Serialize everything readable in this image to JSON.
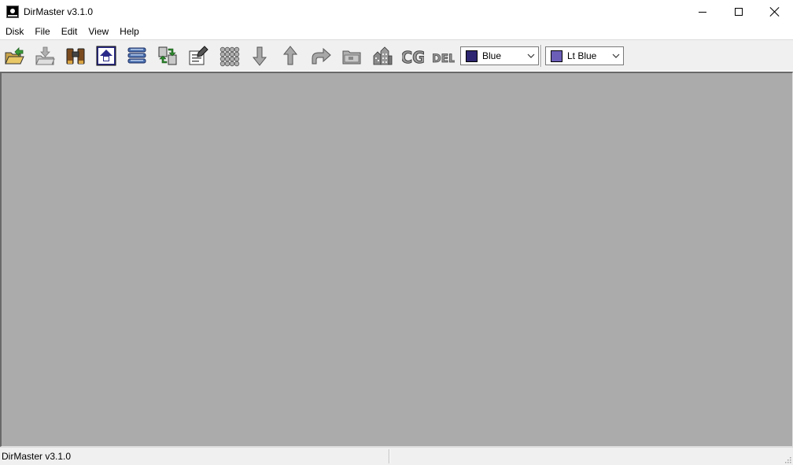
{
  "window": {
    "title": "DirMaster v3.1.0",
    "controls": [
      "minimize-icon",
      "maximize-icon",
      "close-icon"
    ]
  },
  "menu": {
    "items": [
      "Disk",
      "File",
      "Edit",
      "View",
      "Help"
    ]
  },
  "toolbar": {
    "buttons": [
      "open-folder-icon",
      "import-icon",
      "binoculars-icon",
      "commodore-logo-icon",
      "list-icon",
      "swap-icon",
      "edit-file-icon",
      "grid-dots-icon",
      "arrow-down-icon",
      "arrow-up-icon",
      "redo-arrow-icon",
      "folder-icon",
      "city-icon",
      "cg-icon",
      "del-icon"
    ],
    "cg_text": "CG",
    "del_text": "DEL",
    "background_color": {
      "selected": "Blue",
      "swatch": "#2e2670"
    },
    "foreground_color": {
      "selected": "Lt Blue",
      "swatch": "#6b5eb8"
    }
  },
  "workspace": {
    "background": "#ababab"
  },
  "status": {
    "text": "DirMaster v3.1.0"
  }
}
